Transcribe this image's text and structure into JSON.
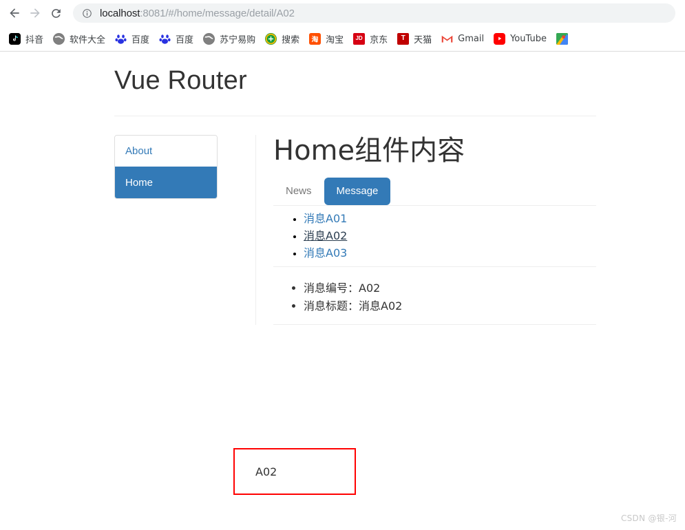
{
  "browser": {
    "back_label": "Back",
    "forward_label": "Forward",
    "reload_label": "Reload",
    "site_info_label": "View site information",
    "url": "localhost:8081/#/home/message/detail/A02",
    "url_host": "localhost",
    "url_path": ":8081/#/home/message/detail/A02",
    "bookmarks": [
      {
        "label": "抖音",
        "icon": "douyin-icon",
        "glyph": "♪"
      },
      {
        "label": "软件大全",
        "icon": "globe-icon",
        "glyph": "🌐"
      },
      {
        "label": "百度",
        "icon": "baidu-icon",
        "glyph": "熊"
      },
      {
        "label": "百度",
        "icon": "baidu-icon",
        "glyph": "熊"
      },
      {
        "label": "苏宁易购",
        "icon": "globe-icon",
        "glyph": "🌐"
      },
      {
        "label": "搜索",
        "icon": "sou-icon",
        "glyph": "+"
      },
      {
        "label": "淘宝",
        "icon": "taobao-icon",
        "glyph": "淘"
      },
      {
        "label": "京东",
        "icon": "jd-icon",
        "glyph": "JD"
      },
      {
        "label": "天猫",
        "icon": "tmall-icon",
        "glyph": "T"
      },
      {
        "label": "Gmail",
        "icon": "gmail-icon",
        "glyph": "M"
      },
      {
        "label": "YouTube",
        "icon": "youtube-icon",
        "glyph": "▶"
      },
      {
        "label": "",
        "icon": "maps-icon",
        "glyph": ""
      }
    ]
  },
  "page": {
    "title": "Vue Router",
    "side_nav": [
      {
        "label": "About",
        "active": false
      },
      {
        "label": "Home",
        "active": true
      }
    ],
    "content": {
      "heading": "Home组件内容",
      "tabs": [
        {
          "label": "News",
          "active": false
        },
        {
          "label": "Message",
          "active": true
        }
      ],
      "messages": [
        {
          "label": "消息A01",
          "current": false
        },
        {
          "label": "消息A02",
          "current": true
        },
        {
          "label": "消息A03",
          "current": false
        }
      ],
      "detail": [
        "消息编号：A02",
        "消息标题：消息A02"
      ],
      "annotation_text": "A02"
    }
  },
  "colors": {
    "accent_blue": "#337ab7",
    "annotation_red": "#ff0000",
    "link_blue": "#337ab7",
    "text_dark": "#333333"
  },
  "watermark": "CSDN @银-河"
}
